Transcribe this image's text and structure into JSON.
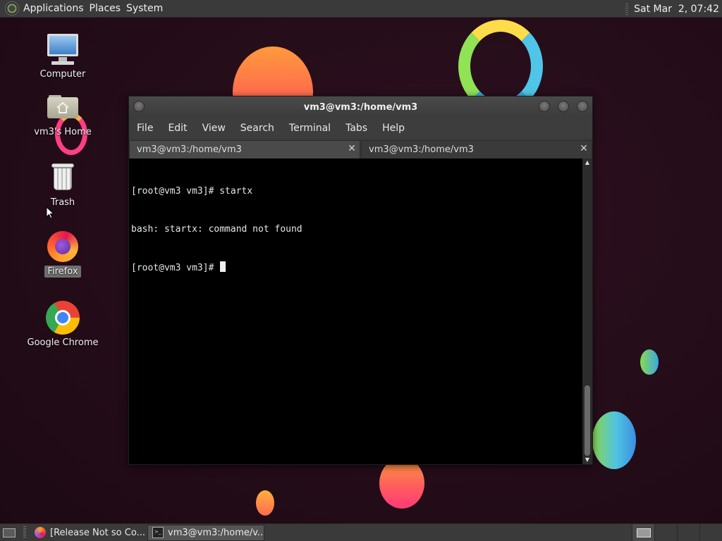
{
  "top_panel": {
    "menus": [
      "Applications",
      "Places",
      "System"
    ],
    "clock": "Sat Mar  2, 07:42"
  },
  "desktop_icons": [
    {
      "label": "Computer",
      "icon": "computer-icon"
    },
    {
      "label": "vm3's Home",
      "icon": "home-folder-icon"
    },
    {
      "label": "Trash",
      "icon": "trash-icon"
    },
    {
      "label": "Firefox",
      "icon": "firefox-icon",
      "selected": true
    },
    {
      "label": "Google Chrome",
      "icon": "chrome-icon"
    }
  ],
  "terminal": {
    "title": "vm3@vm3:/home/vm3",
    "menu": [
      "File",
      "Edit",
      "View",
      "Search",
      "Terminal",
      "Tabs",
      "Help"
    ],
    "tabs": [
      {
        "label": "vm3@vm3:/home/vm3",
        "active": false
      },
      {
        "label": "vm3@vm3:/home/vm3",
        "active": true
      }
    ],
    "lines": [
      "[root@vm3 vm3]# startx",
      "bash: startx: command not found",
      "[root@vm3 vm3]# "
    ]
  },
  "taskbar": {
    "tasks": [
      {
        "label": "[Release Not so Co...",
        "icon": "firefox-icon"
      },
      {
        "label": "vm3@vm3:/home/v...",
        "icon": "terminal-icon",
        "active": true
      }
    ]
  },
  "colors": {
    "panel": "#3a3a3a",
    "terminal_bg": "#000000",
    "terminal_fg": "#e6e6e6",
    "wallpaper": "#230c18"
  }
}
